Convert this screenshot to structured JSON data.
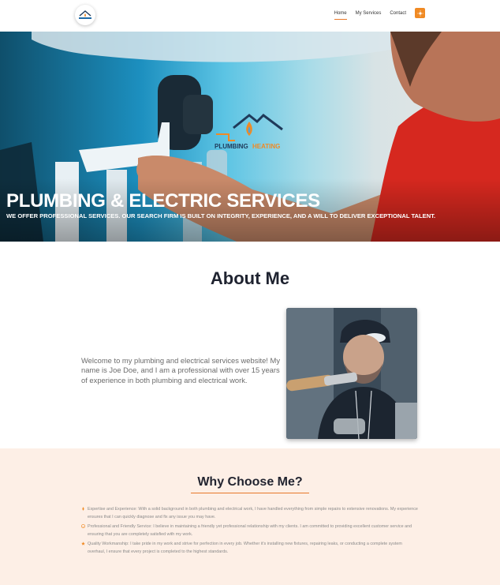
{
  "header": {
    "logo": {
      "icon": "house-flame-logo-icon"
    },
    "nav": [
      {
        "label": "Home",
        "active": true
      },
      {
        "label": "My Services",
        "active": false
      },
      {
        "label": "Contact",
        "active": false
      }
    ],
    "theme_toggle_icon": "sun-icon",
    "accent_color": "#f08a24"
  },
  "hero": {
    "title": "PLUMBING & ELECTRIC SERVICES",
    "subtitle": "WE OFFER PROFESSIONAL SERVICES. OUR SEARCH FIRM IS BUILT ON INTEGRITY, EXPERIENCE, AND A WILL TO DELIVER EXCEPTIONAL TALENT.",
    "logo_word_heating": "HEATING",
    "logo_word_plumbing": "PLUMBING"
  },
  "about": {
    "title": "About Me",
    "text": "Welcome to my plumbing and electrical services website! My name is Joe Doe, and I am a professional with over 15 years of experience in both plumbing and electrical work."
  },
  "why": {
    "title": "Why Choose Me?",
    "items": [
      {
        "icon": "flame-icon",
        "text": "Expertise and Experience: With a solid background in both plumbing and electrical work, I have handled everything from simple repairs to extensive renovations. My experience ensures that I can quickly diagnose and fix any issue you may have."
      },
      {
        "icon": "smile-icon",
        "text": "Professional and Friendly Service: I believe in maintaining a friendly yet professional relationship with my clients. I am committed to providing excellent customer service and ensuring that you are completely satisfied with my work."
      },
      {
        "icon": "star-icon",
        "text": "Quality Workmanship: I take pride in my work and strive for perfection in every job. Whether it's installing new fixtures, repairing leaks, or conducting a complete system overhaul, I ensure that every project is completed to the highest standards."
      }
    ]
  }
}
